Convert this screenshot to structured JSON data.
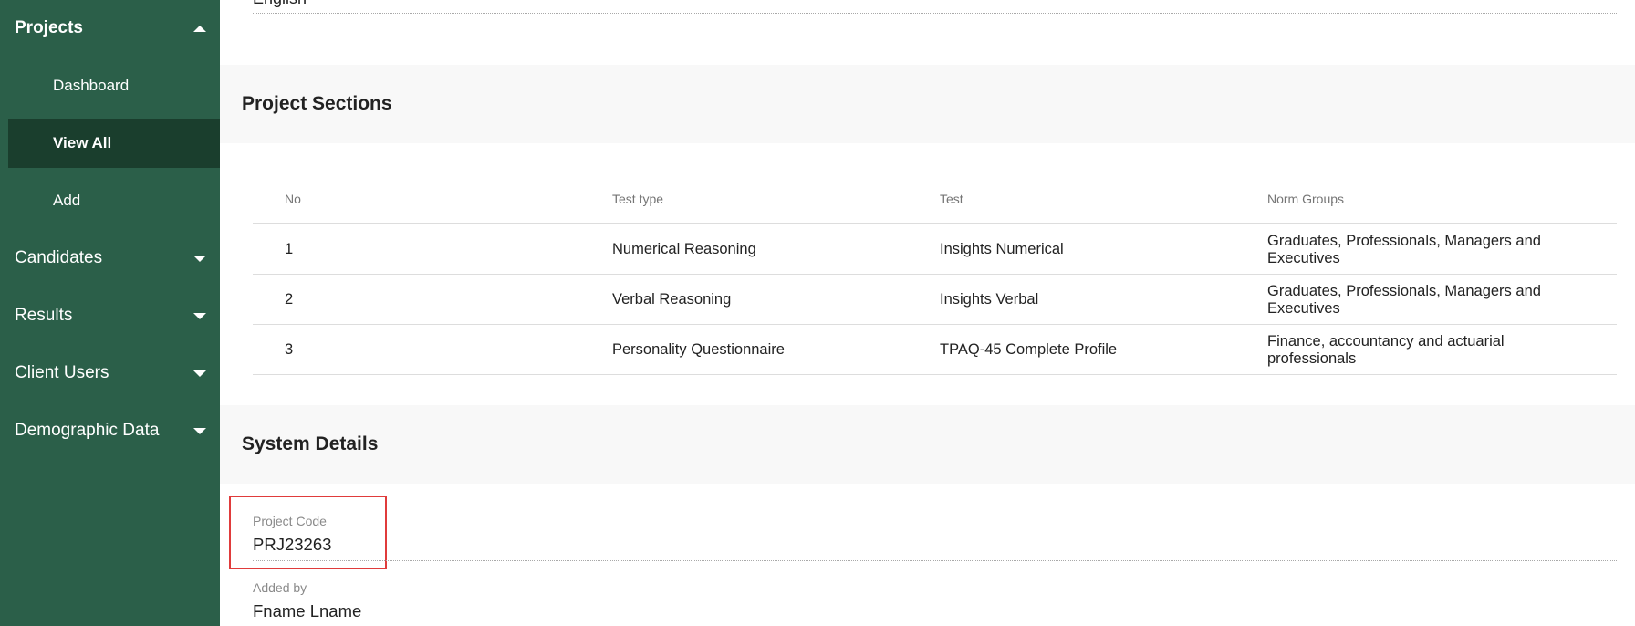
{
  "sidebar": {
    "projects": {
      "label": "Projects",
      "expanded": true,
      "children": [
        {
          "label": "Dashboard",
          "active": false
        },
        {
          "label": "View All",
          "active": true
        },
        {
          "label": "Add",
          "active": false
        }
      ]
    },
    "items": [
      {
        "label": "Candidates"
      },
      {
        "label": "Results"
      },
      {
        "label": "Client Users"
      },
      {
        "label": "Demographic Data"
      }
    ]
  },
  "main": {
    "top_field_value": "English",
    "project_sections": {
      "title": "Project Sections",
      "columns": [
        "No",
        "Test type",
        "Test",
        "Norm Groups"
      ],
      "rows": [
        {
          "no": "1",
          "test_type": "Numerical Reasoning",
          "test": "Insights Numerical",
          "norm_groups": "Graduates, Professionals, Managers and Executives"
        },
        {
          "no": "2",
          "test_type": "Verbal Reasoning",
          "test": "Insights Verbal",
          "norm_groups": "Graduates, Professionals, Managers and Executives"
        },
        {
          "no": "3",
          "test_type": "Personality Questionnaire",
          "test": "TPAQ-45 Complete Profile",
          "norm_groups": "Finance, accountancy and actuarial professionals"
        }
      ]
    },
    "system_details": {
      "title": "System Details",
      "project_code_label": "Project Code",
      "project_code_value": "PRJ23263",
      "added_by_label": "Added by",
      "added_by_value": "Fname Lname"
    }
  },
  "colors": {
    "sidebar_bg": "#2b5f49",
    "active_item_bg": "#1a3e2d",
    "highlight_border": "#e03b3b"
  }
}
